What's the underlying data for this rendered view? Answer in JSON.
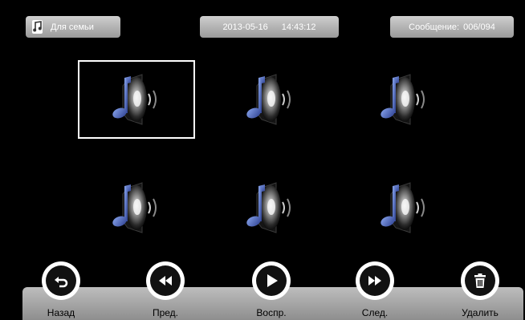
{
  "header": {
    "title": "Для семьи",
    "title_icon": "music-note-icon",
    "date": "2013-05-16",
    "time": "14:43:12",
    "message_label": "Сообщение:",
    "message_count": "006/094"
  },
  "grid": {
    "items": [
      {
        "icon": "audio-file-icon",
        "selected": true
      },
      {
        "icon": "audio-file-icon",
        "selected": false
      },
      {
        "icon": "audio-file-icon",
        "selected": false
      },
      {
        "icon": "audio-file-icon",
        "selected": false
      },
      {
        "icon": "audio-file-icon",
        "selected": false
      },
      {
        "icon": "audio-file-icon",
        "selected": false
      }
    ]
  },
  "controls": {
    "back_label": "Назад",
    "prev_label": "Пред.",
    "play_label": "Воспр.",
    "next_label": "След.",
    "delete_label": "Удалить"
  },
  "colors": {
    "background": "#000000",
    "pill": "#b5b5b5",
    "note_blue": "#2f4ea6"
  }
}
